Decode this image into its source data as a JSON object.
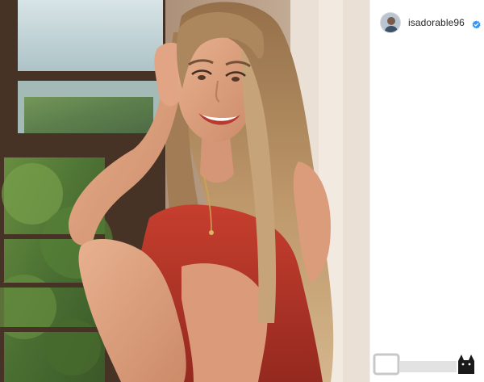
{
  "post": {
    "username": "isadorable96",
    "verified": true
  },
  "icons": {
    "avatar": "profile-picture",
    "verified": "verified-badge-icon",
    "watermark": "cat-silhouette-logo"
  },
  "colors": {
    "username": "#262626",
    "verified_badge": "#3897f0",
    "panel_bg": "#ffffff",
    "dress": "#b52a22"
  }
}
